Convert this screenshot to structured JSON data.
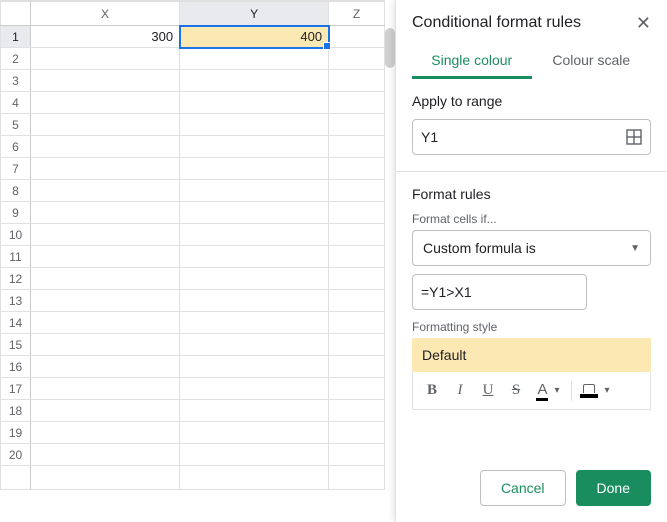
{
  "sheet": {
    "columns": [
      "X",
      "Y",
      "Z"
    ],
    "active_col_index": 1,
    "row_count": 20,
    "active_row": 1,
    "cells": {
      "X1": "300",
      "Y1": "400"
    },
    "highlighted": [
      "Y1"
    ],
    "selected": "Y1"
  },
  "panel": {
    "title": "Conditional format rules",
    "tabs": {
      "single": "Single colour",
      "scale": "Colour scale"
    },
    "apply_label": "Apply to range",
    "apply_value": "Y1",
    "rules_label": "Format rules",
    "format_cells_if_label": "Format cells if...",
    "condition_selected": "Custom formula is",
    "formula_value": "=Y1>X1",
    "style_label": "Formatting style",
    "style_preview": "Default",
    "buttons": {
      "cancel": "Cancel",
      "done": "Done"
    }
  },
  "icons": {
    "bold": "B",
    "italic": "I",
    "underline": "U",
    "strike": "S",
    "textcolor": "A"
  }
}
